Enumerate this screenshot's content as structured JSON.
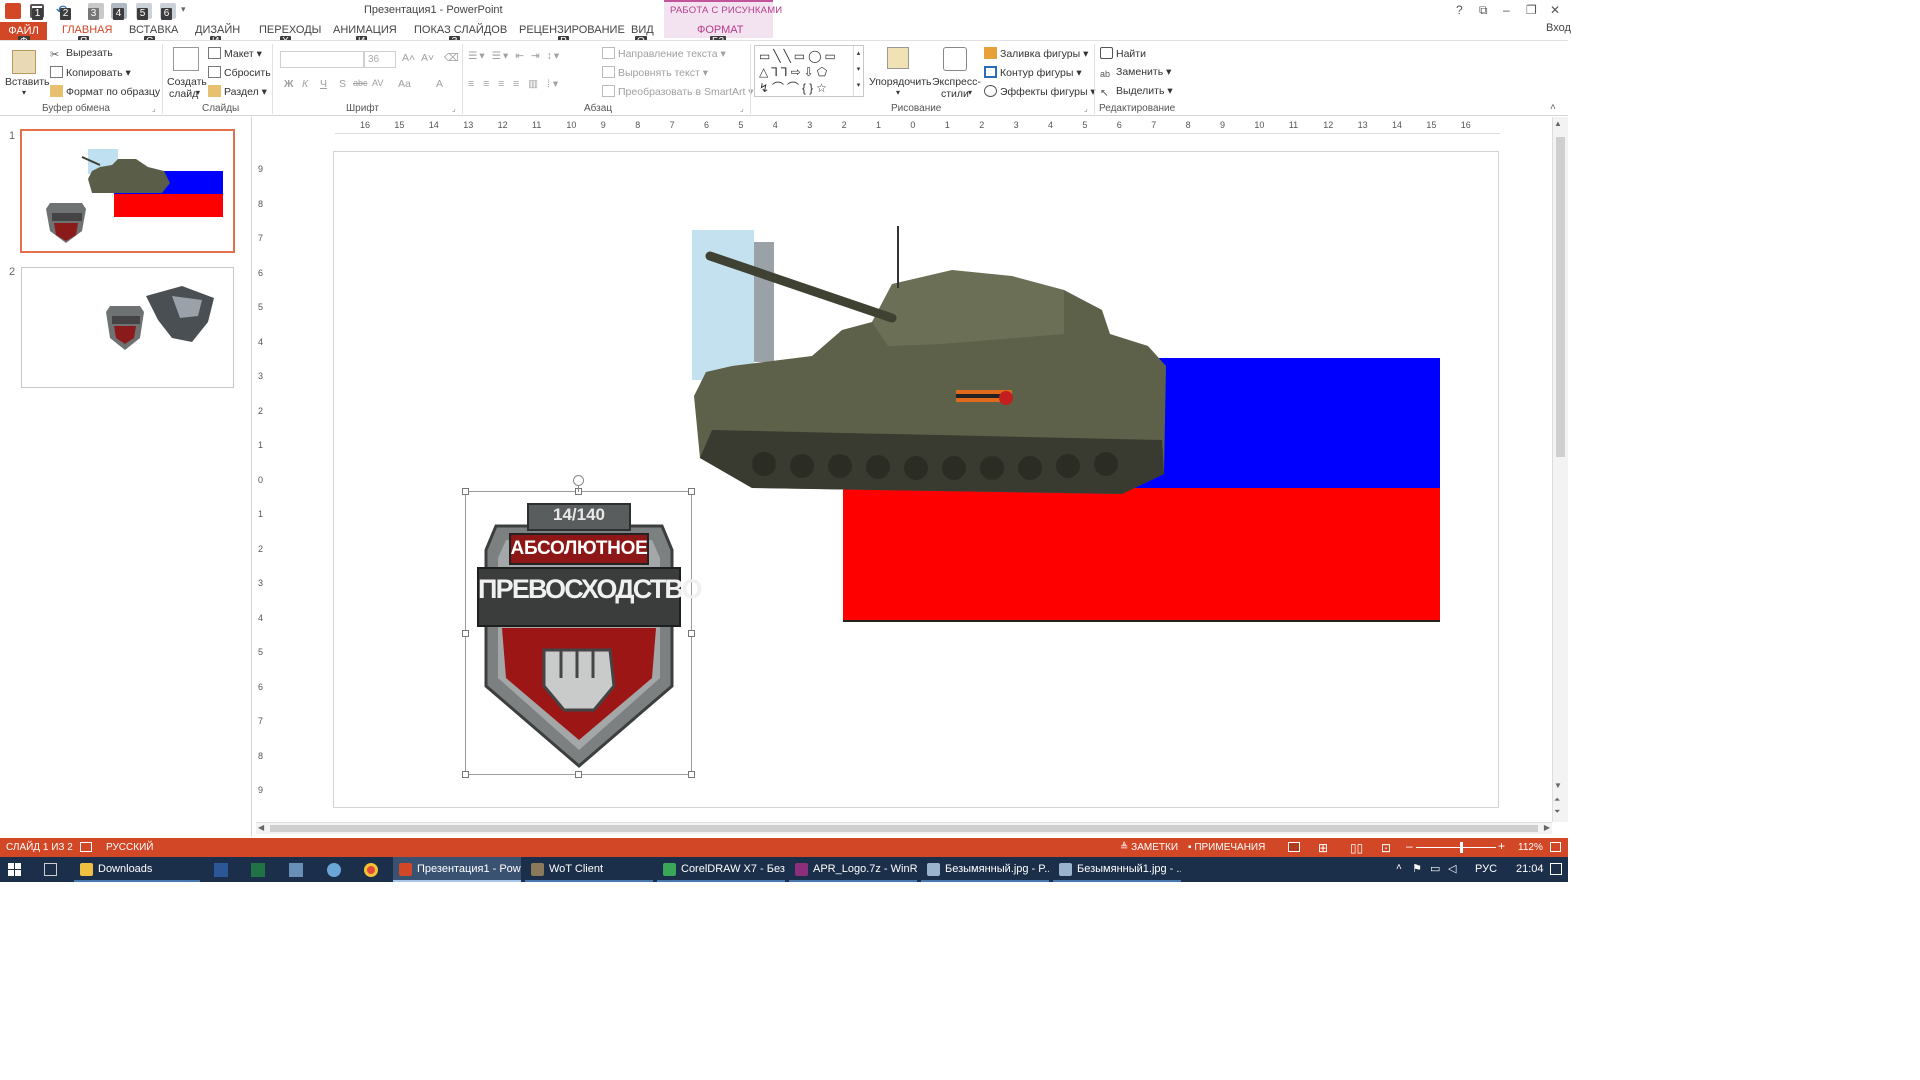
{
  "window": {
    "title": "Презентация1 - PowerPoint",
    "context_group": "РАБОТА С РИСУНКАМИ",
    "login": "Вход",
    "help": "?",
    "controls": [
      "⧉",
      "–",
      "❐",
      "✕"
    ]
  },
  "keytips": {
    "qat": [
      "1",
      "2",
      "3",
      "4",
      "5",
      "6"
    ],
    "tabs": [
      "Ф",
      "Я",
      "С",
      "Й",
      "Х",
      "И",
      "З",
      "Р",
      "О",
      "Б3"
    ]
  },
  "tabs": [
    "ФАЙЛ",
    "ГЛАВНАЯ",
    "ВСТАВКА",
    "ДИЗАЙН",
    "ПЕРЕХОДЫ",
    "АНИМАЦИЯ",
    "ПОКАЗ СЛАЙДОВ",
    "РЕЦЕНЗИРОВАНИЕ",
    "ВИД",
    "ФОРМАТ"
  ],
  "ribbon": {
    "clipboard": {
      "label": "Буфер обмена",
      "paste": "Вставить",
      "cut": "Вырезать",
      "copy": "Копировать",
      "format_painter": "Формат по образцу"
    },
    "slides": {
      "label": "Слайды",
      "new_slide_1": "Создать",
      "new_slide_2": "слайд",
      "layout": "Макет",
      "reset": "Сбросить",
      "section": "Раздел"
    },
    "font": {
      "label": "Шрифт",
      "size": "36",
      "bold": "Ж",
      "italic": "К",
      "underline": "Ч",
      "shadow": "S",
      "strike": "abc",
      "spacing": "AV",
      "case": "Aa",
      "color": "A"
    },
    "paragraph": {
      "label": "Абзац",
      "text_direction": "Направление текста",
      "align_text": "Выровнять текст",
      "smartart": "Преобразовать в SmartArt"
    },
    "drawing": {
      "label": "Рисование",
      "arrange": "Упорядочить",
      "quick_styles_1": "Экспресс-",
      "quick_styles_2": "стили",
      "fill": "Заливка фигуры",
      "outline": "Контур фигуры",
      "effects": "Эффекты фигуры"
    },
    "editing": {
      "label": "Редактирование",
      "find": "Найти",
      "replace": "Заменить",
      "select": "Выделить"
    }
  },
  "thumbnails": [
    "1",
    "2"
  ],
  "ruler": {
    "h_ticks": [
      "16",
      "15",
      "14",
      "13",
      "12",
      "11",
      "10",
      "9",
      "8",
      "7",
      "6",
      "5",
      "4",
      "3",
      "2",
      "1",
      "0",
      "1",
      "2",
      "3",
      "4",
      "5",
      "6",
      "7",
      "8",
      "9",
      "10",
      "11",
      "12",
      "13",
      "14",
      "15",
      "16"
    ],
    "v_ticks": [
      "9",
      "8",
      "7",
      "6",
      "5",
      "4",
      "3",
      "2",
      "1",
      "0",
      "1",
      "2",
      "3",
      "4",
      "5",
      "6",
      "7",
      "8",
      "9"
    ]
  },
  "slide": {
    "badge_top": "14/140",
    "badge_line1": "АБСОЛЮТНОЕ",
    "badge_line2": "ПРЕВОСХОДСТВО",
    "flag_colors": [
      "#ffffff",
      "#0000ff",
      "#ff0000"
    ]
  },
  "status": {
    "slide": "СЛАЙД 1 ИЗ 2",
    "language": "РУССКИЙ",
    "notes": "ЗАМЕТКИ",
    "comments": "ПРИМЕЧАНИЯ",
    "zoom": "112%",
    "zoom_level": 0.56
  },
  "taskbar": {
    "items": [
      "Downloads",
      "Презентация1 - Pow...",
      "WoT Client",
      "CorelDRAW X7 - Без...",
      "APR_Logo.7z - WinR...",
      "Безымянный.jpg - P...",
      "Безымянный1.jpg - ..."
    ],
    "lang": "РУС",
    "time": "21:04"
  }
}
